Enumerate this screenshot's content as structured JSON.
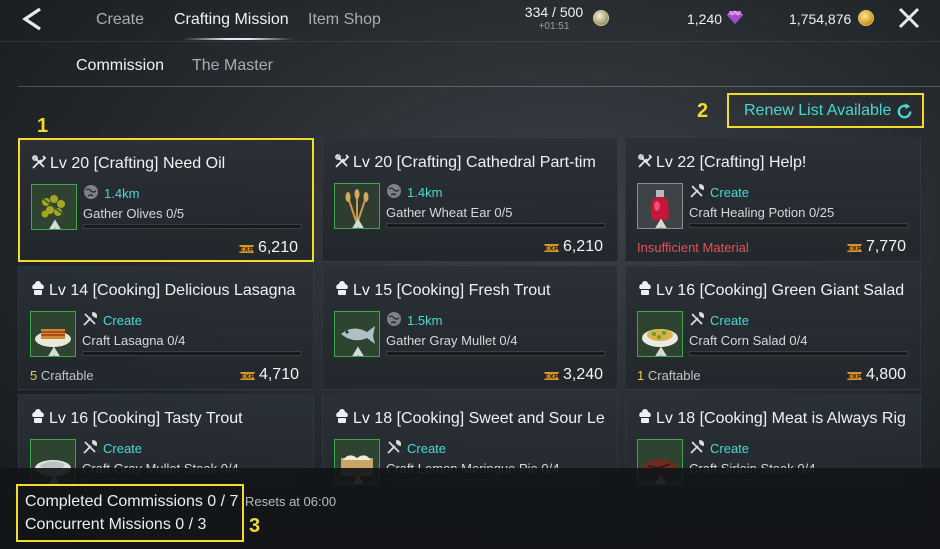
{
  "topbar": {
    "tabs": [
      {
        "label": "Create",
        "active": false
      },
      {
        "label": "Crafting Mission",
        "active": true
      },
      {
        "label": "Item Shop",
        "active": false
      }
    ],
    "stamina": "334 / 500",
    "stamina_regen": "+01:51",
    "gems": "1,240",
    "gold": "1,754,876"
  },
  "subtabs": [
    {
      "label": "Commission",
      "active": true
    },
    {
      "label": "The Master",
      "active": false
    }
  ],
  "renew_label": "Renew List Available",
  "markers": {
    "one": "1",
    "two": "2",
    "three": "3"
  },
  "cards": [
    {
      "type": "crafting",
      "title": "Lv 20  [Crafting] Need Oil",
      "activity": "1.4km",
      "activity_type": "gather",
      "task": "Gather Olives 0/5",
      "progress": 0,
      "footer_num": "",
      "footer_label": "",
      "footer_warn": "",
      "exp": "6,210",
      "thumb": "olives-icon",
      "highlight": true
    },
    {
      "type": "crafting",
      "title": "Lv 20  [Crafting] Cathedral Part-tim",
      "activity": "1.4km",
      "activity_type": "gather",
      "task": "Gather Wheat Ear 0/5",
      "progress": 0,
      "footer_num": "",
      "footer_label": "",
      "footer_warn": "",
      "exp": "6,210",
      "thumb": "wheat-icon",
      "highlight": false
    },
    {
      "type": "crafting",
      "title": "Lv 22  [Crafting] Help!",
      "activity": "Create",
      "activity_type": "create",
      "task": "Craft Healing Potion 0/25",
      "progress": 0,
      "footer_num": "",
      "footer_label": "",
      "footer_warn": "Insufficient Material",
      "exp": "7,770",
      "thumb": "potion-icon",
      "highlight": false
    },
    {
      "type": "cooking",
      "title": "Lv 14  [Cooking] Delicious Lasagna",
      "activity": "Create",
      "activity_type": "create",
      "task": "Craft Lasagna 0/4",
      "progress": 0,
      "footer_num": "5",
      "footer_label": "Craftable",
      "footer_warn": "",
      "exp": "4,710",
      "thumb": "lasagna-icon",
      "highlight": false
    },
    {
      "type": "cooking",
      "title": "Lv 15  [Cooking] Fresh Trout",
      "activity": "1.5km",
      "activity_type": "gather",
      "task": "Gather Gray Mullet 0/4",
      "progress": 0,
      "footer_num": "",
      "footer_label": "",
      "footer_warn": "",
      "exp": "3,240",
      "thumb": "fish-icon",
      "highlight": false
    },
    {
      "type": "cooking",
      "title": "Lv 16  [Cooking] Green Giant Salad",
      "activity": "Create",
      "activity_type": "create",
      "task": "Craft Corn Salad 0/4",
      "progress": 0,
      "footer_num": "1",
      "footer_label": "Craftable",
      "footer_warn": "",
      "exp": "4,800",
      "thumb": "salad-icon",
      "highlight": false
    },
    {
      "type": "cooking",
      "title": "Lv 16  [Cooking] Tasty Trout",
      "activity": "Create",
      "activity_type": "create",
      "task": "Craft Gray Mullet Steak 0/4",
      "progress": 0,
      "footer_num": "",
      "footer_label": "",
      "footer_warn": "",
      "exp": "",
      "thumb": "fish-steak-icon",
      "highlight": false
    },
    {
      "type": "cooking",
      "title": "Lv 18  [Cooking] Sweet and Sour Le",
      "activity": "Create",
      "activity_type": "create",
      "task": "Craft Lemon Meringue Pie 0/4",
      "progress": 0,
      "footer_num": "",
      "footer_label": "",
      "footer_warn": "",
      "exp": "",
      "thumb": "pie-icon",
      "highlight": false
    },
    {
      "type": "cooking",
      "title": "Lv 18  [Cooking] Meat is Always Rig",
      "activity": "Create",
      "activity_type": "create",
      "task": "Craft Sirloin Steak 0/4",
      "progress": 0,
      "footer_num": "",
      "footer_label": "",
      "footer_warn": "",
      "exp": "",
      "thumb": "steak-icon",
      "highlight": false
    }
  ],
  "summary": {
    "completed": "Completed Commissions 0 / 7",
    "concurrent": "Concurrent Missions 0 / 3",
    "reset": "Resets at 06:00"
  },
  "colors": {
    "accent": "#46d9d3",
    "highlight": "#f2dc2a",
    "warn": "#e45252",
    "craftable": "#e8c94c"
  }
}
